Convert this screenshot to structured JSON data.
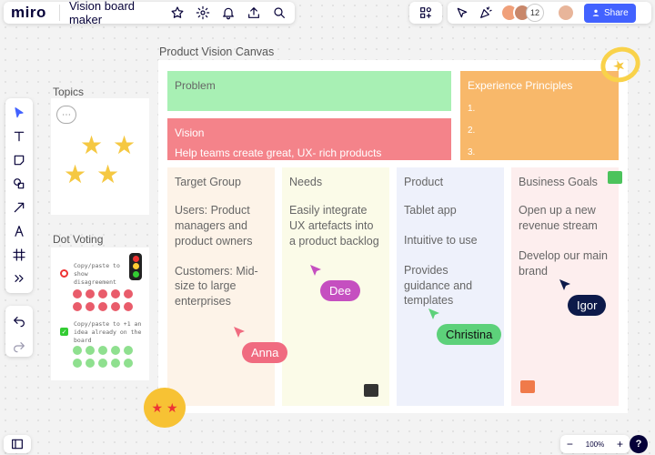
{
  "app": {
    "logo": "miro",
    "board_name": "Vision board maker"
  },
  "topbar": {
    "icons": [
      "star-icon",
      "gear-icon",
      "bell-icon",
      "upload-icon",
      "search-icon"
    ],
    "collaborators_count": "12",
    "share_label": "Share"
  },
  "sidebar": {
    "topics_label": "Topics",
    "dot_voting_label": "Dot Voting",
    "dot_voting": {
      "disagree_text": "Copy/paste to show disagreement",
      "agree_text": "Copy/paste to +1 an idea already on the board",
      "disagree_color": "#e95c6b",
      "agree_color": "#8fe08f"
    }
  },
  "canvas": {
    "title": "Product Vision Canvas",
    "problem": {
      "title": "Problem",
      "color": "#a8f0b4"
    },
    "vision": {
      "title": "Vision",
      "text": "Help teams create great, UX- rich products",
      "color": "#f4838a"
    },
    "experience": {
      "title": "Experience Principles",
      "items": [
        "1.",
        "2.",
        "3."
      ],
      "color": "#f8b86a"
    },
    "columns": [
      {
        "title": "Target Group",
        "items": [
          "Users: Product managers and product owners",
          "Customers: Mid-size to large enterprises"
        ],
        "color": "#fdf3e8"
      },
      {
        "title": "Needs",
        "items": [
          "Easily integrate UX artefacts into a product backlog"
        ],
        "color": "#fbfbe8"
      },
      {
        "title": "Product",
        "items": [
          "Tablet app",
          "Intuitive to use",
          "Provides guidance and templates"
        ],
        "color": "#eef1fb"
      },
      {
        "title": "Business Goals",
        "items": [
          "Open up a new revenue stream",
          "Develop our main brand"
        ],
        "color": "#fdeeee"
      }
    ]
  },
  "cursors": [
    {
      "name": "Anna",
      "color": "#f06b80"
    },
    {
      "name": "Dee",
      "color": "#c54fc0"
    },
    {
      "name": "Christina",
      "color": "#5dd17a"
    },
    {
      "name": "Igor",
      "color": "#0d1a4a"
    }
  ],
  "zoom": {
    "level": "100%",
    "minus": "−",
    "plus": "+"
  },
  "help_label": "?"
}
